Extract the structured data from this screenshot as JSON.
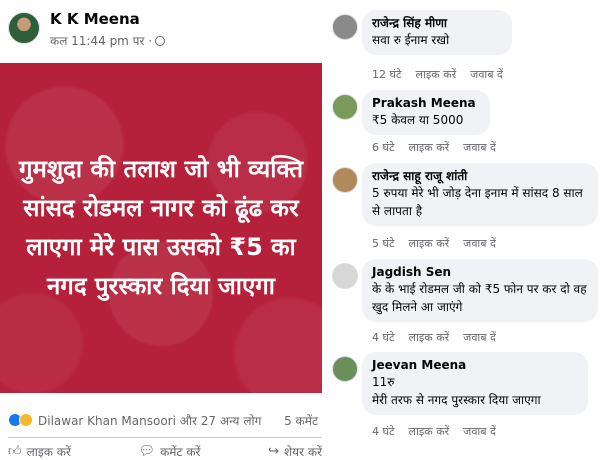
{
  "post": {
    "author": "K K Meena",
    "time": "कल 11:44 pm पर ·",
    "text": "गुमशुदा की तलाश जो भी व्यक्ति सांसद रोडमल नागर को ढूंढ कर लाएगा मेरे पास उसको ₹5 का नगद पुरस्कार दिया जाएगा",
    "background_color": "#b5213a",
    "reactors": "Dilawar Khan Mansoori और 27 अन्य लोग",
    "comment_count": "5 कमेंट",
    "actions": {
      "like": "लाइक करें",
      "comment": "कमेंट करें",
      "share": "शेयर करें"
    }
  },
  "comments": [
    {
      "name": "राजेन्द्र सिंह मीणा",
      "text": "सवा रु ईनाम रखो",
      "time": "12 घंटे",
      "like": "लाइक करें",
      "reply": "जवाब दें"
    },
    {
      "name": "Prakash Meena",
      "text": "₹5 केवल या 5000",
      "time": "6 घंटे",
      "like": "लाइक करें",
      "reply": "जवाब दें"
    },
    {
      "name": "राजेन्द्र साहू राजू शांती",
      "text": "5 रुपया मेरे भी जोड़ देना इनाम में सांसद 8 साल से लापता है",
      "time": "5 घंटे",
      "like": "लाइक करें",
      "reply": "जवाब दें"
    },
    {
      "name": "Jagdish Sen",
      "text": "के के भाई रोडमल जी को ₹5 फोन पर कर दो वह खुद मिलने आ जाएंगे",
      "time": "4 घंटे",
      "like": "लाइक करें",
      "reply": "जवाब दें"
    },
    {
      "name": "Jeevan Meena",
      "text_line1": "11रु",
      "text_line2": "मेरी तरफ से नगद पुरस्कार दिया जाएगा",
      "time": "4 घंटे",
      "like": "लाइक करें",
      "reply": "जवाब दें"
    }
  ]
}
